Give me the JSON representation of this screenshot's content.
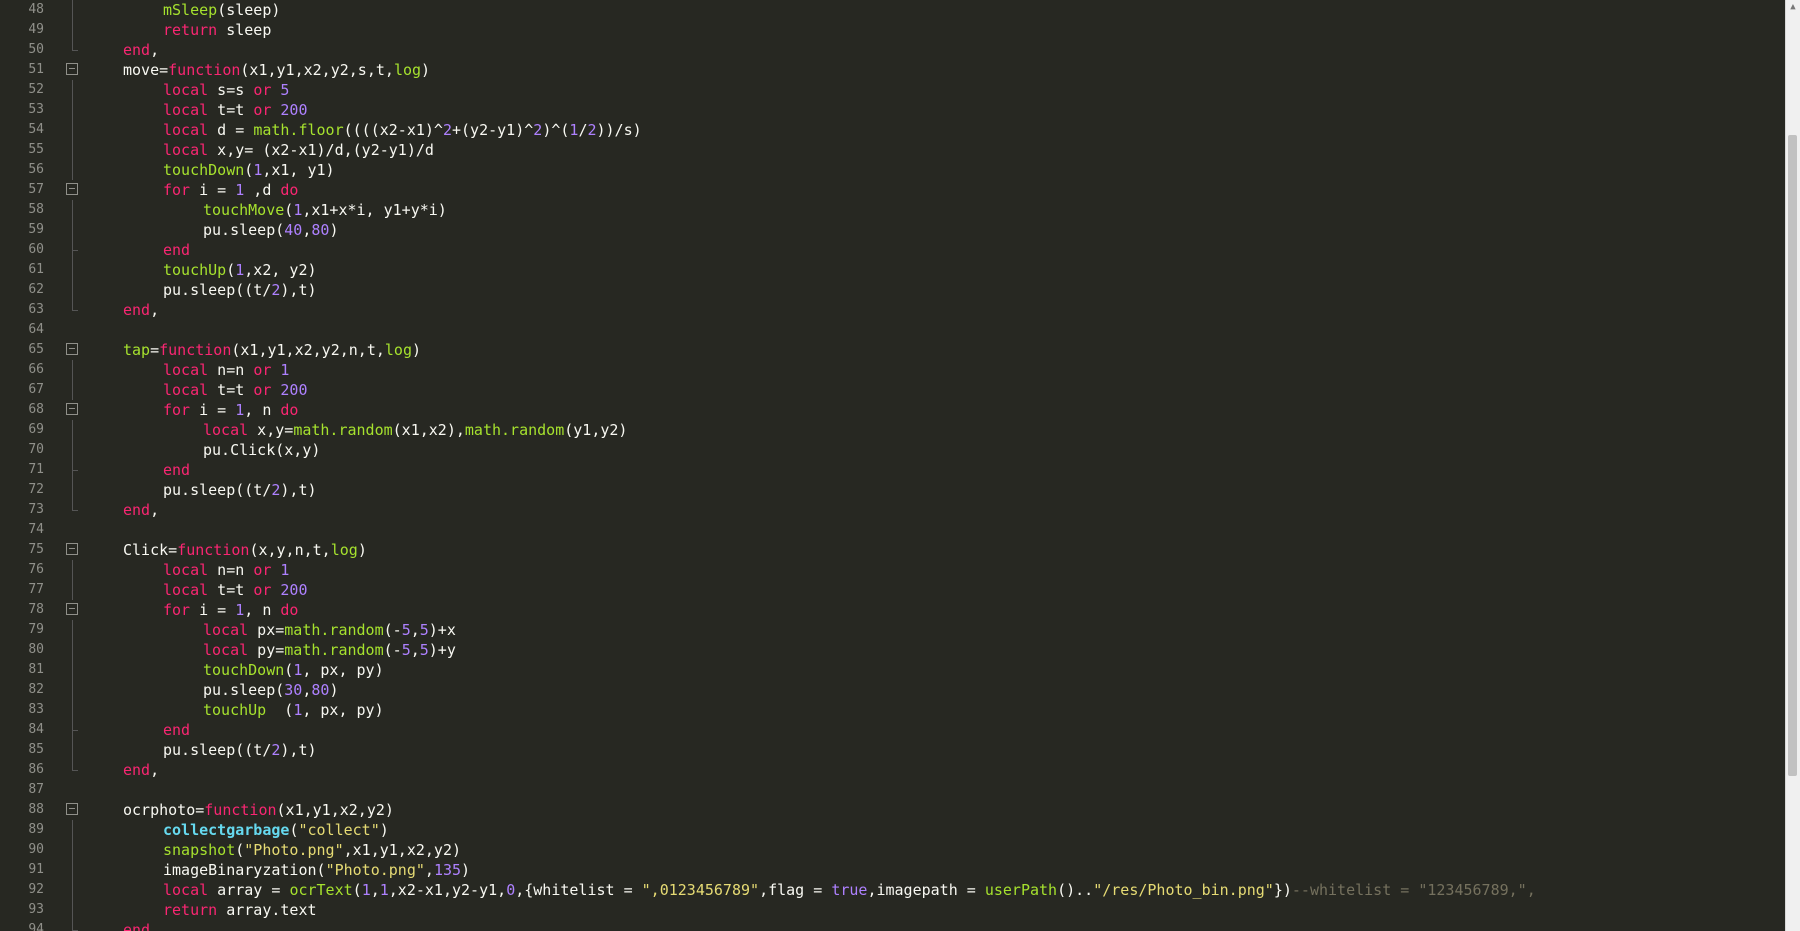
{
  "editor": {
    "lines": [
      {
        "n": "48",
        "ind": 2,
        "fold": "",
        "v": 1,
        "tick": 0,
        "tokens": [
          [
            "f",
            "mSleep"
          ],
          [
            "",
            "(sleep)"
          ]
        ]
      },
      {
        "n": "49",
        "ind": 2,
        "fold": "",
        "v": 1,
        "tick": 0,
        "tokens": [
          [
            "k",
            "return"
          ],
          [
            "",
            " sleep"
          ]
        ]
      },
      {
        "n": "50",
        "ind": 1,
        "fold": "",
        "v": 0,
        "tick": 1,
        "tokens": [
          [
            "k",
            "end"
          ],
          [
            "",
            ","
          ]
        ]
      },
      {
        "n": "51",
        "ind": 1,
        "fold": "minus",
        "v": 0,
        "tick": 0,
        "tokens": [
          [
            "",
            "move="
          ],
          [
            "k",
            "function"
          ],
          [
            "",
            "(x1,y1,x2,y2,s,t,"
          ],
          [
            "f",
            "log"
          ],
          [
            "",
            ")"
          ]
        ]
      },
      {
        "n": "52",
        "ind": 2,
        "fold": "",
        "v": 1,
        "tick": 0,
        "tokens": [
          [
            "k",
            "local"
          ],
          [
            "",
            " s=s "
          ],
          [
            "k",
            "or"
          ],
          [
            "",
            " "
          ],
          [
            "n",
            "5"
          ]
        ]
      },
      {
        "n": "53",
        "ind": 2,
        "fold": "",
        "v": 1,
        "tick": 0,
        "tokens": [
          [
            "k",
            "local"
          ],
          [
            "",
            " t=t "
          ],
          [
            "k",
            "or"
          ],
          [
            "",
            " "
          ],
          [
            "n",
            "200"
          ]
        ]
      },
      {
        "n": "54",
        "ind": 2,
        "fold": "",
        "v": 1,
        "tick": 0,
        "tokens": [
          [
            "k",
            "local"
          ],
          [
            "",
            " d = "
          ],
          [
            "f",
            "math.floor"
          ],
          [
            "",
            "((((x2-x1)^"
          ],
          [
            "n",
            "2"
          ],
          [
            "",
            "+(y2-y1)^"
          ],
          [
            "n",
            "2"
          ],
          [
            "",
            ")^("
          ],
          [
            "n",
            "1"
          ],
          [
            "",
            "/"
          ],
          [
            "n",
            "2"
          ],
          [
            "",
            "))/s)"
          ]
        ]
      },
      {
        "n": "55",
        "ind": 2,
        "fold": "",
        "v": 1,
        "tick": 0,
        "tokens": [
          [
            "k",
            "local"
          ],
          [
            "",
            " x,y= (x2-x1)/d,(y2-y1)/d"
          ]
        ]
      },
      {
        "n": "56",
        "ind": 2,
        "fold": "",
        "v": 1,
        "tick": 0,
        "tokens": [
          [
            "f",
            "touchDown"
          ],
          [
            "",
            "("
          ],
          [
            "n",
            "1"
          ],
          [
            "",
            ",x1, y1)"
          ]
        ]
      },
      {
        "n": "57",
        "ind": 2,
        "fold": "minus",
        "v": 0,
        "tick": 0,
        "tokens": [
          [
            "k",
            "for"
          ],
          [
            "",
            " i = "
          ],
          [
            "n",
            "1"
          ],
          [
            "",
            " ,d "
          ],
          [
            "k",
            "do"
          ]
        ]
      },
      {
        "n": "58",
        "ind": 3,
        "fold": "",
        "v": 1,
        "tick": 0,
        "tokens": [
          [
            "f",
            "touchMove"
          ],
          [
            "",
            "("
          ],
          [
            "n",
            "1"
          ],
          [
            "",
            ",x1+x*i, y1+y*i)"
          ]
        ]
      },
      {
        "n": "59",
        "ind": 3,
        "fold": "",
        "v": 1,
        "tick": 0,
        "tokens": [
          [
            "",
            "pu.sleep("
          ],
          [
            "n",
            "40"
          ],
          [
            "",
            ","
          ],
          [
            "n",
            "80"
          ],
          [
            "",
            ")"
          ]
        ]
      },
      {
        "n": "60",
        "ind": 2,
        "fold": "",
        "v": 1,
        "tick": 1,
        "tokens": [
          [
            "k",
            "end"
          ]
        ]
      },
      {
        "n": "61",
        "ind": 2,
        "fold": "",
        "v": 1,
        "tick": 0,
        "tokens": [
          [
            "f",
            "touchUp"
          ],
          [
            "",
            "("
          ],
          [
            "n",
            "1"
          ],
          [
            "",
            ",x2, y2)"
          ]
        ]
      },
      {
        "n": "62",
        "ind": 2,
        "fold": "",
        "v": 1,
        "tick": 0,
        "tokens": [
          [
            "",
            "pu.sleep((t/"
          ],
          [
            "n",
            "2"
          ],
          [
            "",
            "),t)"
          ]
        ]
      },
      {
        "n": "63",
        "ind": 1,
        "fold": "",
        "v": 0,
        "tick": 1,
        "tokens": [
          [
            "k",
            "end"
          ],
          [
            "",
            ","
          ]
        ]
      },
      {
        "n": "64",
        "ind": 0,
        "fold": "",
        "v": 0,
        "tick": 0,
        "tokens": []
      },
      {
        "n": "65",
        "ind": 1,
        "fold": "minus",
        "v": 0,
        "tick": 0,
        "tokens": [
          [
            "f",
            "tap"
          ],
          [
            "",
            "="
          ],
          [
            "k",
            "function"
          ],
          [
            "",
            "(x1,y1,x2,y2,n,t,"
          ],
          [
            "f",
            "log"
          ],
          [
            "",
            ")"
          ]
        ]
      },
      {
        "n": "66",
        "ind": 2,
        "fold": "",
        "v": 1,
        "tick": 0,
        "tokens": [
          [
            "k",
            "local"
          ],
          [
            "",
            " n=n "
          ],
          [
            "k",
            "or"
          ],
          [
            "",
            " "
          ],
          [
            "n",
            "1"
          ]
        ]
      },
      {
        "n": "67",
        "ind": 2,
        "fold": "",
        "v": 1,
        "tick": 0,
        "tokens": [
          [
            "k",
            "local"
          ],
          [
            "",
            " t=t "
          ],
          [
            "k",
            "or"
          ],
          [
            "",
            " "
          ],
          [
            "n",
            "200"
          ]
        ]
      },
      {
        "n": "68",
        "ind": 2,
        "fold": "minus",
        "v": 0,
        "tick": 0,
        "tokens": [
          [
            "k",
            "for"
          ],
          [
            "",
            " i = "
          ],
          [
            "n",
            "1"
          ],
          [
            "",
            ", n "
          ],
          [
            "k",
            "do"
          ]
        ]
      },
      {
        "n": "69",
        "ind": 3,
        "fold": "",
        "v": 1,
        "tick": 0,
        "tokens": [
          [
            "k",
            "local"
          ],
          [
            "",
            " x,y="
          ],
          [
            "f",
            "math.random"
          ],
          [
            "",
            "(x1,x2),"
          ],
          [
            "f",
            "math.random"
          ],
          [
            "",
            "(y1,y2)"
          ]
        ]
      },
      {
        "n": "70",
        "ind": 3,
        "fold": "",
        "v": 1,
        "tick": 0,
        "tokens": [
          [
            "",
            "pu.Click(x,y)"
          ]
        ]
      },
      {
        "n": "71",
        "ind": 2,
        "fold": "",
        "v": 1,
        "tick": 1,
        "tokens": [
          [
            "k",
            "end"
          ]
        ]
      },
      {
        "n": "72",
        "ind": 2,
        "fold": "",
        "v": 1,
        "tick": 0,
        "tokens": [
          [
            "",
            "pu.sleep((t/"
          ],
          [
            "n",
            "2"
          ],
          [
            "",
            "),t)"
          ]
        ]
      },
      {
        "n": "73",
        "ind": 1,
        "fold": "",
        "v": 0,
        "tick": 1,
        "tokens": [
          [
            "k",
            "end"
          ],
          [
            "",
            ","
          ]
        ]
      },
      {
        "n": "74",
        "ind": 0,
        "fold": "",
        "v": 0,
        "tick": 0,
        "tokens": []
      },
      {
        "n": "75",
        "ind": 1,
        "fold": "minus",
        "v": 0,
        "tick": 0,
        "tokens": [
          [
            "",
            "Click="
          ],
          [
            "k",
            "function"
          ],
          [
            "",
            "(x,y,n,t,"
          ],
          [
            "f",
            "log"
          ],
          [
            "",
            ")"
          ]
        ]
      },
      {
        "n": "76",
        "ind": 2,
        "fold": "",
        "v": 1,
        "tick": 0,
        "tokens": [
          [
            "k",
            "local"
          ],
          [
            "",
            " n=n "
          ],
          [
            "k",
            "or"
          ],
          [
            "",
            " "
          ],
          [
            "n",
            "1"
          ]
        ]
      },
      {
        "n": "77",
        "ind": 2,
        "fold": "",
        "v": 1,
        "tick": 0,
        "tokens": [
          [
            "k",
            "local"
          ],
          [
            "",
            " t=t "
          ],
          [
            "k",
            "or"
          ],
          [
            "",
            " "
          ],
          [
            "n",
            "200"
          ]
        ]
      },
      {
        "n": "78",
        "ind": 2,
        "fold": "minus",
        "v": 0,
        "tick": 0,
        "tokens": [
          [
            "k",
            "for"
          ],
          [
            "",
            " i = "
          ],
          [
            "n",
            "1"
          ],
          [
            "",
            ", n "
          ],
          [
            "k",
            "do"
          ]
        ]
      },
      {
        "n": "79",
        "ind": 3,
        "fold": "",
        "v": 1,
        "tick": 0,
        "tokens": [
          [
            "k",
            "local"
          ],
          [
            "",
            " px="
          ],
          [
            "f",
            "math.random"
          ],
          [
            "",
            "(-"
          ],
          [
            "n",
            "5"
          ],
          [
            "",
            ","
          ],
          [
            "n",
            "5"
          ],
          [
            "",
            ")+x"
          ]
        ]
      },
      {
        "n": "80",
        "ind": 3,
        "fold": "",
        "v": 1,
        "tick": 0,
        "tokens": [
          [
            "k",
            "local"
          ],
          [
            "",
            " py="
          ],
          [
            "f",
            "math.random"
          ],
          [
            "",
            "(-"
          ],
          [
            "n",
            "5"
          ],
          [
            "",
            ","
          ],
          [
            "n",
            "5"
          ],
          [
            "",
            ")+y"
          ]
        ]
      },
      {
        "n": "81",
        "ind": 3,
        "fold": "",
        "v": 1,
        "tick": 0,
        "tokens": [
          [
            "f",
            "touchDown"
          ],
          [
            "",
            "("
          ],
          [
            "n",
            "1"
          ],
          [
            "",
            ", px, py)"
          ]
        ]
      },
      {
        "n": "82",
        "ind": 3,
        "fold": "",
        "v": 1,
        "tick": 0,
        "tokens": [
          [
            "",
            "pu.sleep("
          ],
          [
            "n",
            "30"
          ],
          [
            "",
            ","
          ],
          [
            "n",
            "80"
          ],
          [
            "",
            ")"
          ]
        ]
      },
      {
        "n": "83",
        "ind": 3,
        "fold": "",
        "v": 1,
        "tick": 0,
        "tokens": [
          [
            "f",
            "touchUp"
          ],
          [
            "",
            "  ("
          ],
          [
            "n",
            "1"
          ],
          [
            "",
            ", px, py)"
          ]
        ]
      },
      {
        "n": "84",
        "ind": 2,
        "fold": "",
        "v": 1,
        "tick": 1,
        "tokens": [
          [
            "k",
            "end"
          ]
        ]
      },
      {
        "n": "85",
        "ind": 2,
        "fold": "",
        "v": 1,
        "tick": 0,
        "tokens": [
          [
            "",
            "pu.sleep((t/"
          ],
          [
            "n",
            "2"
          ],
          [
            "",
            "),t)"
          ]
        ]
      },
      {
        "n": "86",
        "ind": 1,
        "fold": "",
        "v": 0,
        "tick": 1,
        "tokens": [
          [
            "k",
            "end"
          ],
          [
            "",
            ","
          ]
        ]
      },
      {
        "n": "87",
        "ind": 0,
        "fold": "",
        "v": 0,
        "tick": 0,
        "tokens": []
      },
      {
        "n": "88",
        "ind": 1,
        "fold": "minus",
        "v": 0,
        "tick": 0,
        "tokens": [
          [
            "",
            "ocrphoto="
          ],
          [
            "k",
            "function"
          ],
          [
            "",
            "(x1,y1,x2,y2)"
          ]
        ]
      },
      {
        "n": "89",
        "ind": 2,
        "fold": "",
        "v": 1,
        "tick": 0,
        "tokens": [
          [
            "b",
            "collectgarbage"
          ],
          [
            "",
            "("
          ],
          [
            "s",
            "\"collect\""
          ],
          [
            "",
            ")"
          ]
        ]
      },
      {
        "n": "90",
        "ind": 2,
        "fold": "",
        "v": 1,
        "tick": 0,
        "tokens": [
          [
            "f",
            "snapshot"
          ],
          [
            "",
            "("
          ],
          [
            "s",
            "\"Photo.png\""
          ],
          [
            "",
            ",x1,y1,x2,y2)"
          ]
        ]
      },
      {
        "n": "91",
        "ind": 2,
        "fold": "",
        "v": 1,
        "tick": 0,
        "tokens": [
          [
            "",
            "imageBinaryzation("
          ],
          [
            "s",
            "\"Photo.png\""
          ],
          [
            "",
            ","
          ],
          [
            "n",
            "135"
          ],
          [
            "",
            ")"
          ]
        ]
      },
      {
        "n": "92",
        "ind": 2,
        "fold": "",
        "v": 1,
        "tick": 0,
        "tokens": [
          [
            "k",
            "local"
          ],
          [
            "",
            " array = "
          ],
          [
            "f",
            "ocrText"
          ],
          [
            "",
            "("
          ],
          [
            "n",
            "1"
          ],
          [
            "",
            ","
          ],
          [
            "n",
            "1"
          ],
          [
            "",
            ",x2-x1,y2-y1,"
          ],
          [
            "n",
            "0"
          ],
          [
            "",
            ",{whitelist = "
          ],
          [
            "s",
            "\",0123456789\""
          ],
          [
            "",
            ",flag = "
          ],
          [
            "n",
            "true"
          ],
          [
            "",
            ",imagepath = "
          ],
          [
            "f",
            "userPath"
          ],
          [
            "",
            "().."
          ],
          [
            "s",
            "\"/res/Photo_bin.png\""
          ],
          [
            "",
            "})"
          ],
          [
            "c",
            "--whitelist = \"123456789,\","
          ]
        ]
      },
      {
        "n": "93",
        "ind": 2,
        "fold": "",
        "v": 1,
        "tick": 0,
        "tokens": [
          [
            "k",
            "return"
          ],
          [
            "",
            " array.text"
          ]
        ]
      },
      {
        "n": "94",
        "ind": 1,
        "fold": "",
        "v": 0,
        "tick": 1,
        "tokens": [
          [
            "k",
            "end"
          ]
        ]
      }
    ]
  },
  "scrollbar": {
    "position": 0.44
  },
  "icons": {
    "fold": "fold-minus-icon",
    "scroll_up": "scroll-up-arrow-icon"
  }
}
